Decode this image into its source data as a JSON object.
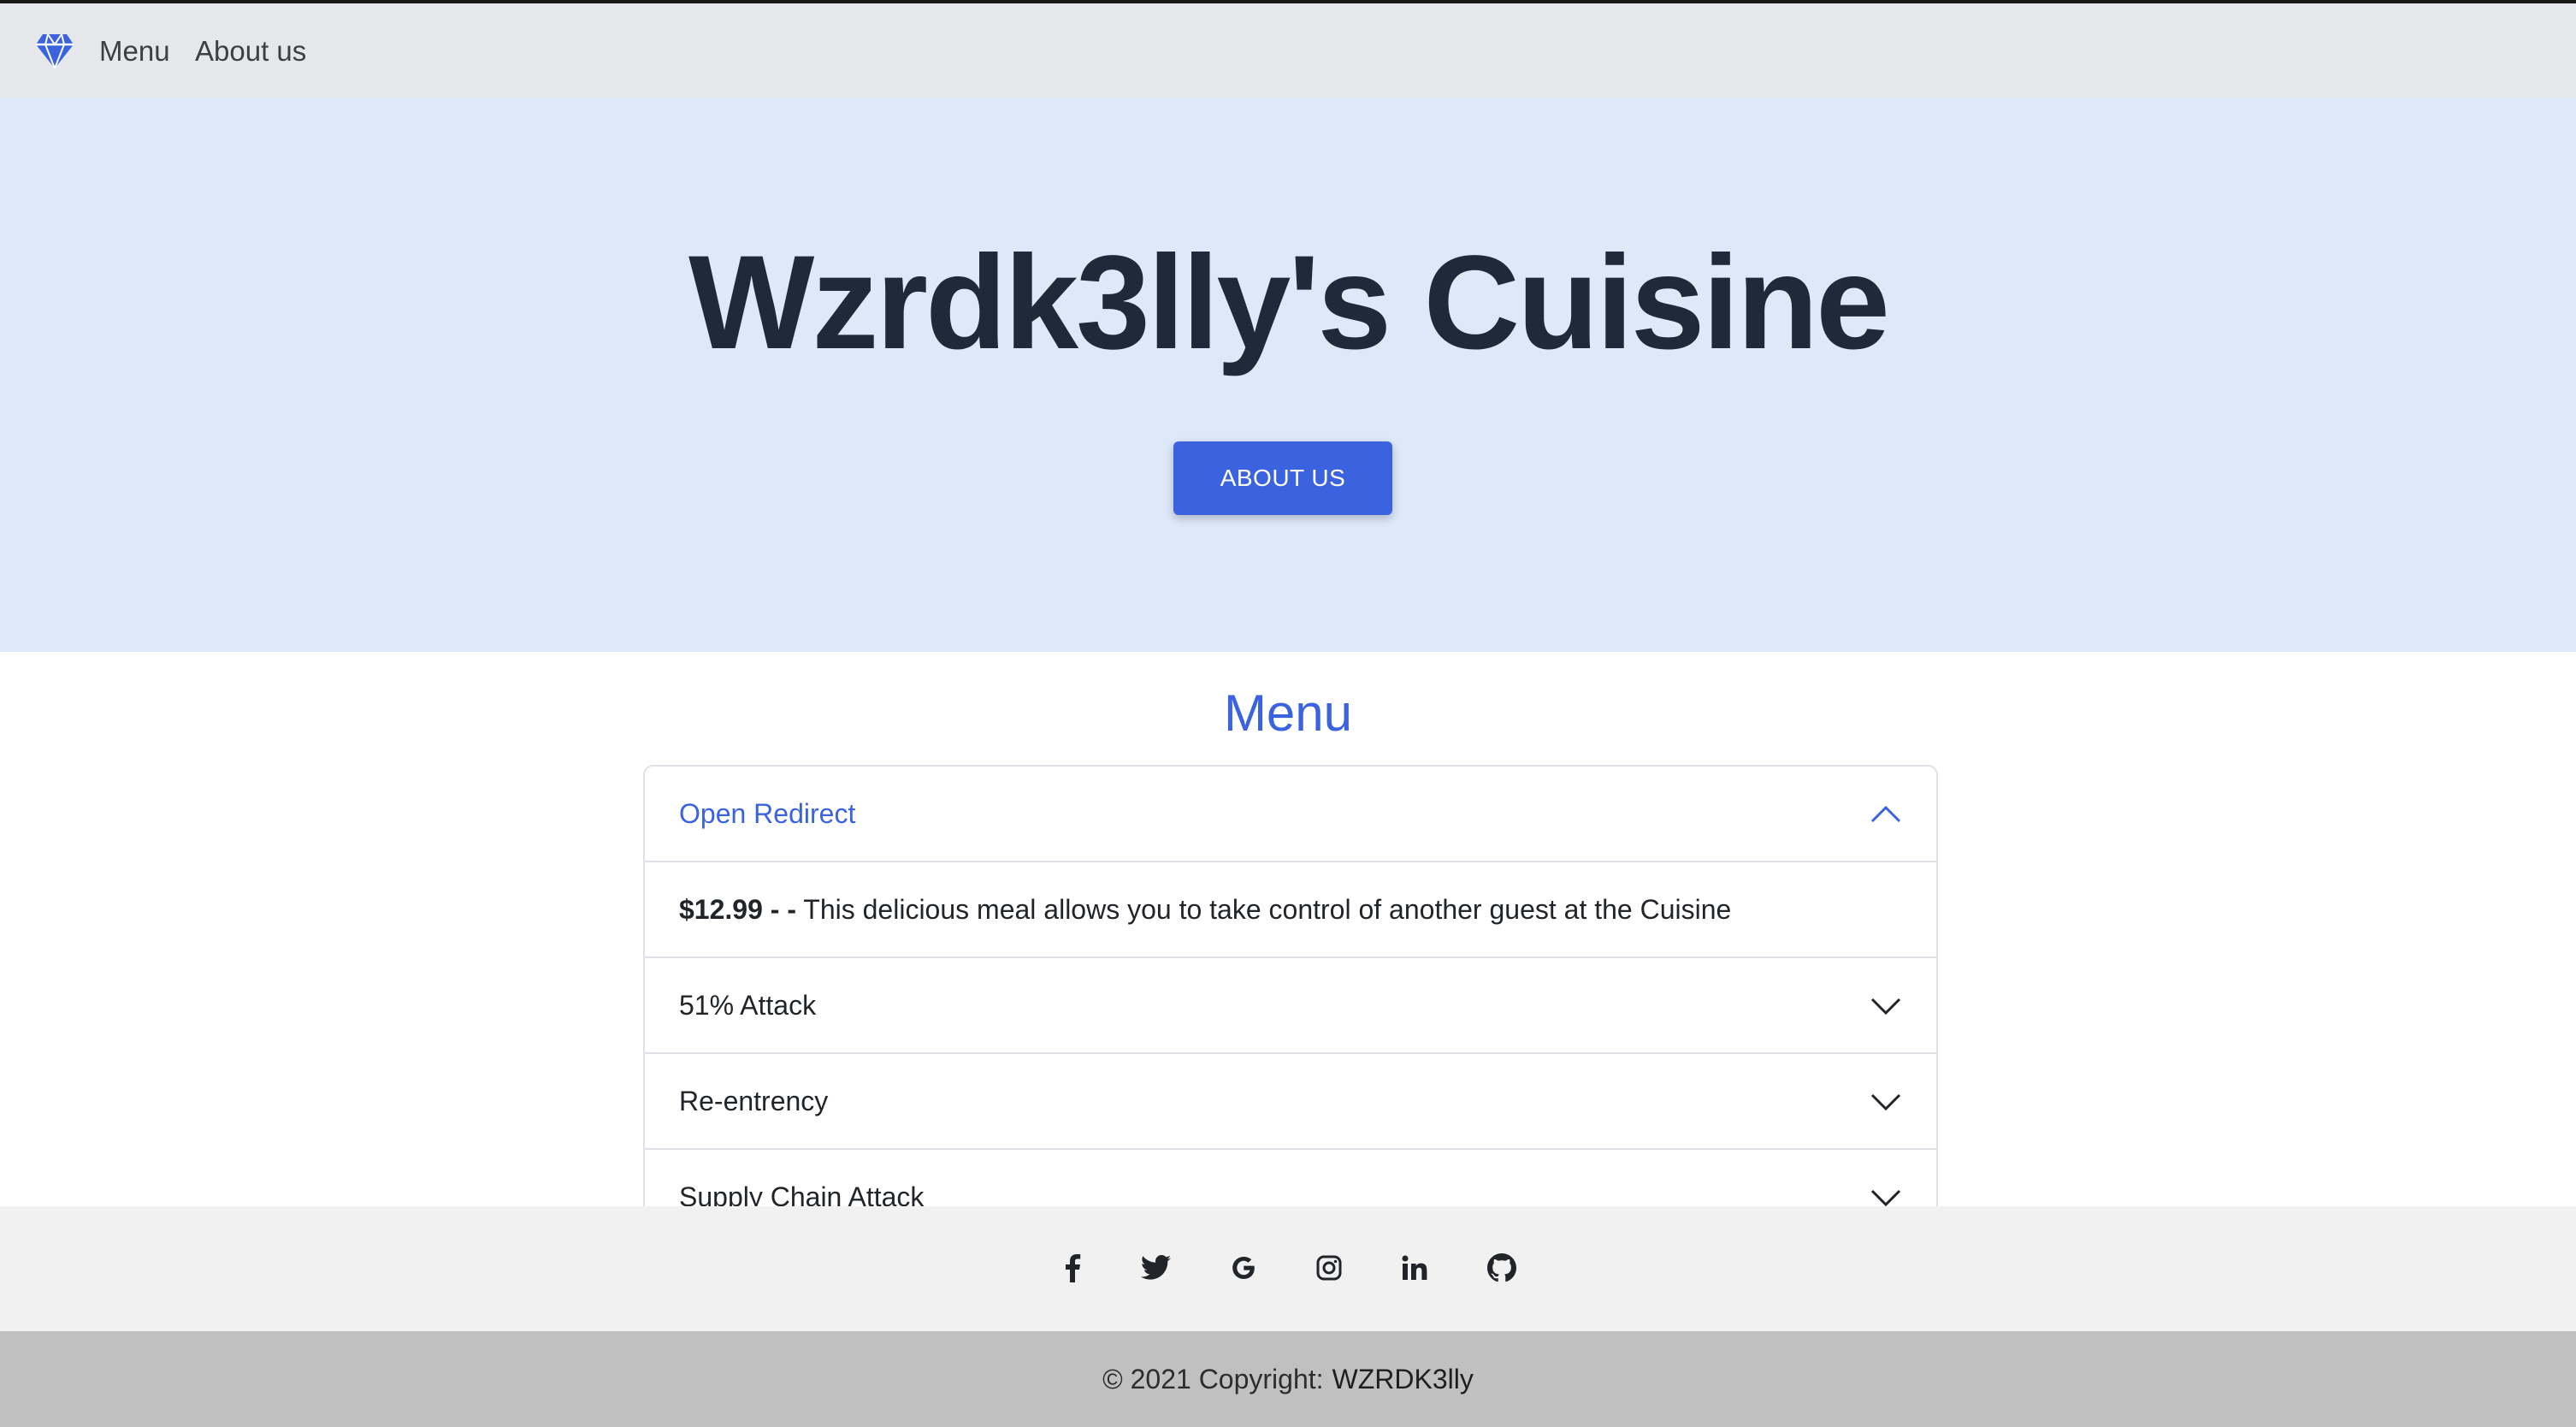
{
  "navbar": {
    "brand_icon": "diamond-icon",
    "links": [
      "Menu",
      "About us"
    ]
  },
  "hero": {
    "title": "Wzrdk3lly's Cuisine",
    "button_label": "ABOUT US"
  },
  "menu": {
    "title": "Menu",
    "items": [
      {
        "label": "Open Redirect",
        "expanded": true,
        "price": "$12.99 - -",
        "description": "This delicious meal allows you to take control of another guest at the Cuisine"
      },
      {
        "label": "51% Attack",
        "expanded": false
      },
      {
        "label": "Re-entrency",
        "expanded": false
      },
      {
        "label": "Supply Chain Attack",
        "expanded": false
      }
    ]
  },
  "footer": {
    "social_icons": [
      "facebook-icon",
      "twitter-icon",
      "google-icon",
      "instagram-icon",
      "linkedin-icon",
      "github-icon"
    ],
    "copyright_prefix": "© 2021 Copyright:",
    "copyright_owner": "WZRDK3lly"
  },
  "colors": {
    "accent": "#3b63e0",
    "hero_bg": "#dde8f8",
    "navbar_bg": "#e6e7ea",
    "footer_bg": "#f1f1f1",
    "copyright_bg": "#c0c0c0"
  }
}
